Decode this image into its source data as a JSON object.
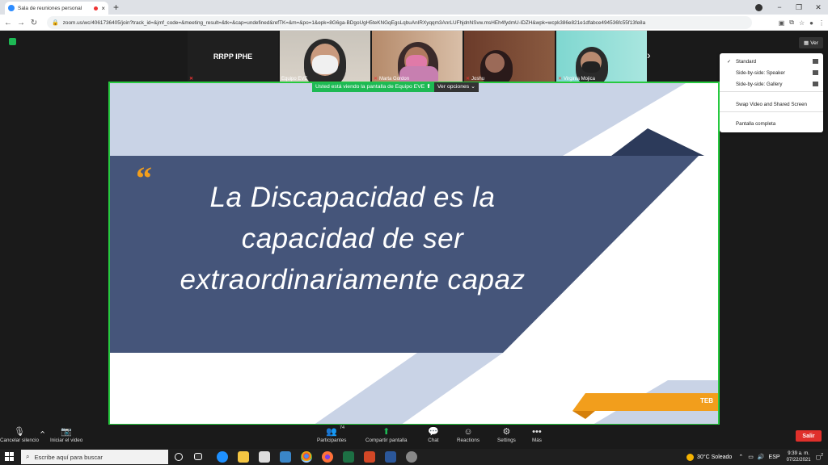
{
  "browser": {
    "tab_title": "Sala de reuniones personal",
    "tab_close": "×",
    "new_tab": "+",
    "url": "zoom.us/wc/4061736405/join?track_id=&jmf_code=&meeting_result=&tk=&cap=undefined&refTK=&m=&po=1&epk=8G6ga-BDgoUgH5teKNGqEgsLqbuAnIRXyqqm3AnrLUFhjdnNSvw.msHEh4fydmU-lDZH&wpk=wcpk386e821e1dfabce494536fc55f13fe8a",
    "back": "←",
    "forward": "→",
    "reload": "↻",
    "minimize": "−",
    "maximize": "❐",
    "close": "✕"
  },
  "zoom": {
    "participants_strip": [
      {
        "name": "RRPP IPHE"
      },
      {
        "name": "Equipo EVE"
      },
      {
        "name": "Marta Gordon"
      },
      {
        "name": "Joshu"
      },
      {
        "name": "Virginia Mojica"
      }
    ],
    "view_button": "Ver",
    "view_menu": [
      "Standard",
      "Side-by-side: Speaker",
      "Side-by-side: Gallery",
      "Swap Video and Shared Screen",
      "Pantalla completa"
    ],
    "viewing_banner": "Usted está viendo la pantalla de Equipo EVE",
    "view_options": "Ver opciones",
    "slide": {
      "quote_mark": "“",
      "lines": [
        "La Discapacidad es la",
        "capacidad de ser",
        "extraordinariamente capaz"
      ],
      "logo": "TEB"
    },
    "controls": {
      "mute": "Cancelar silencio",
      "video": "Iniciar el video",
      "participants": "Participantes",
      "participant_count": "74",
      "share": "Compartir pantalla",
      "chat": "Chat",
      "reactions": "Reactions",
      "settings": "Settings",
      "more": "Más",
      "leave": "Salir"
    }
  },
  "taskbar": {
    "search_placeholder": "Escribe aquí para buscar",
    "weather": "30°C  Soleado",
    "lang": "ESP",
    "time": "9:39 a. m.",
    "date": "07/22/2021",
    "notif": "2"
  },
  "colors": {
    "slide_blue": "#45557a",
    "slide_light": "#c9d3e6",
    "accent_orange": "#f29e1c",
    "active_green": "#27c93f",
    "leave_red": "#e0302b"
  }
}
